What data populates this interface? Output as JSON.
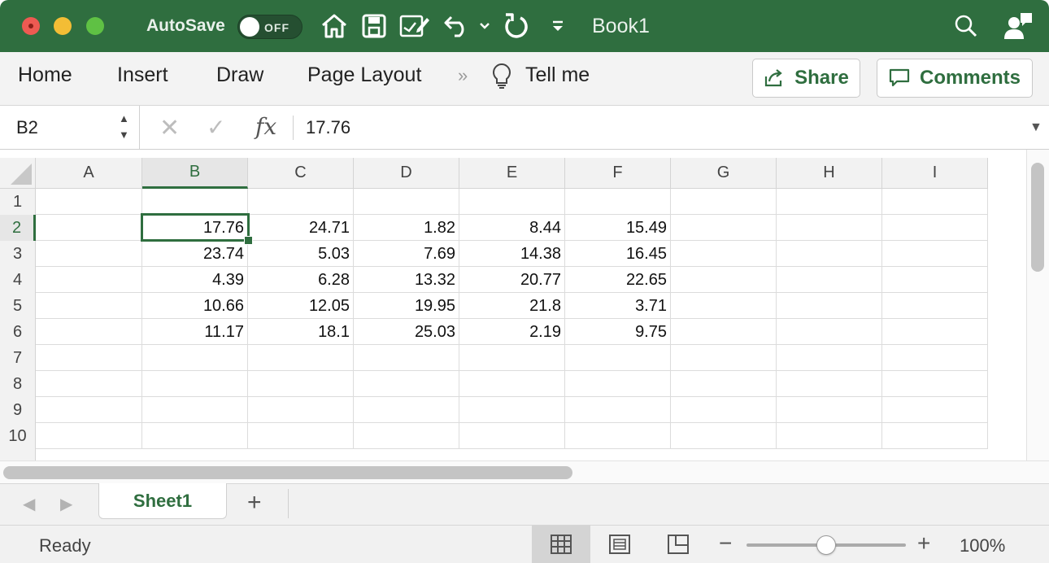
{
  "window": {
    "autosave_label": "AutoSave",
    "autosave_state": "OFF",
    "doc_title": "Book1",
    "accent_color": "#2f6e3f"
  },
  "ribbon": {
    "tabs": [
      "Home",
      "Insert",
      "Draw",
      "Page Layout"
    ],
    "overflow": "»",
    "tell_me": "Tell me",
    "share_label": "Share",
    "comments_label": "Comments"
  },
  "formula_bar": {
    "name_box": "B2",
    "fx_label": "fx",
    "formula": "17.76"
  },
  "grid": {
    "columns": [
      "A",
      "B",
      "C",
      "D",
      "E",
      "F",
      "G",
      "H",
      "I"
    ],
    "rows": [
      "1",
      "2",
      "3",
      "4",
      "5",
      "6",
      "7",
      "8",
      "9",
      "10"
    ],
    "selected_cell": "B2",
    "data": [
      [],
      [
        "",
        "17.76",
        "24.71",
        "1.82",
        "8.44",
        "15.49"
      ],
      [
        "",
        "23.74",
        "5.03",
        "7.69",
        "14.38",
        "16.45"
      ],
      [
        "",
        "4.39",
        "6.28",
        "13.32",
        "20.77",
        "22.65"
      ],
      [
        "",
        "10.66",
        "12.05",
        "19.95",
        "21.8",
        "3.71"
      ],
      [
        "",
        "11.17",
        "18.1",
        "25.03",
        "2.19",
        "9.75"
      ],
      [],
      [],
      [],
      []
    ]
  },
  "sheets": {
    "tabs": [
      "Sheet1"
    ],
    "active": "Sheet1",
    "add_label": "+"
  },
  "status": {
    "text": "Ready",
    "zoom": "100%",
    "zoom_fraction": 0.5,
    "active_view": "normal"
  }
}
